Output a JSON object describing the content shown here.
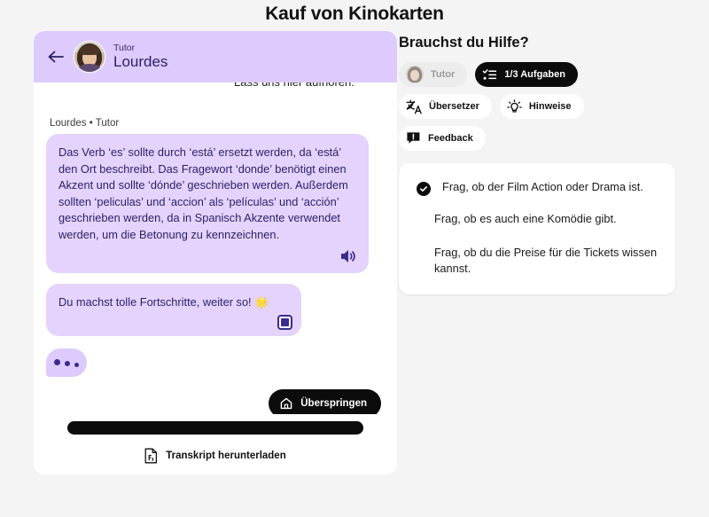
{
  "page": {
    "title": "Kauf von Kinokarten"
  },
  "chat": {
    "header": {
      "back_icon": "arrow-left-icon",
      "avatar_icon": "tutor-avatar",
      "role": "Tutor",
      "name": "Lourdes"
    },
    "clipped_message": "Lass uns hier aufhören.",
    "message_label": "Lourdes • Tutor",
    "messages": [
      {
        "text": "Das Verb ‘es’ sollte durch ‘está’ ersetzt werden, da ‘está’ den Ort beschreibt. Das Fragewort ‘donde’ benötigt einen Akzent und sollte ‘dónde’ geschrieben werden. Außerdem sollten ‘peliculas’ und ‘accion’ als ‘películas’ und ‘acción’ geschrieben werden, da in Spanisch Akzente verwendet werden, um die Betonung zu kennzeichnen.",
        "action_icon": "speaker-icon"
      },
      {
        "text": "Du machst tolle Fortschritte, weiter so! 🌟",
        "action_icon": "stop-icon"
      }
    ],
    "typing_indicator": "typing-dots",
    "skip_button": {
      "label": "Überspringen",
      "icon": "home-icon"
    },
    "footer": {
      "input_placeholder": "",
      "transcript_label": "Transkript herunterladen",
      "transcript_icon": "pdf-file-icon"
    }
  },
  "help": {
    "title": "Brauchst du Hilfe?",
    "chips": [
      {
        "label": "Tutor",
        "icon": "tutor-avatar-icon",
        "state": "disabled"
      },
      {
        "label": "1/3 Aufgaben",
        "icon": "checklist-icon",
        "state": "active"
      },
      {
        "label": "Übersetzer",
        "icon": "translate-icon",
        "state": "default"
      },
      {
        "label": "Hinweise",
        "icon": "lightbulb-icon",
        "state": "default"
      },
      {
        "label": "Feedback",
        "icon": "feedback-bubble-icon",
        "state": "default"
      }
    ],
    "tasks": [
      {
        "text": "Frag, ob der Film Action oder Drama ist.",
        "done": true
      },
      {
        "text": "Frag, ob es auch eine Komödie gibt.",
        "done": false
      },
      {
        "text": "Frag, ob du die Preise für die Tickets wissen kannst.",
        "done": false
      }
    ]
  },
  "colors": {
    "background": "#f4f4f4",
    "panel": "#ffffff",
    "accent_purple": "#ddcbfd",
    "bubble_purple": "#e4d3fc",
    "text_purple": "#2b1f66",
    "black": "#0c0c0c"
  }
}
